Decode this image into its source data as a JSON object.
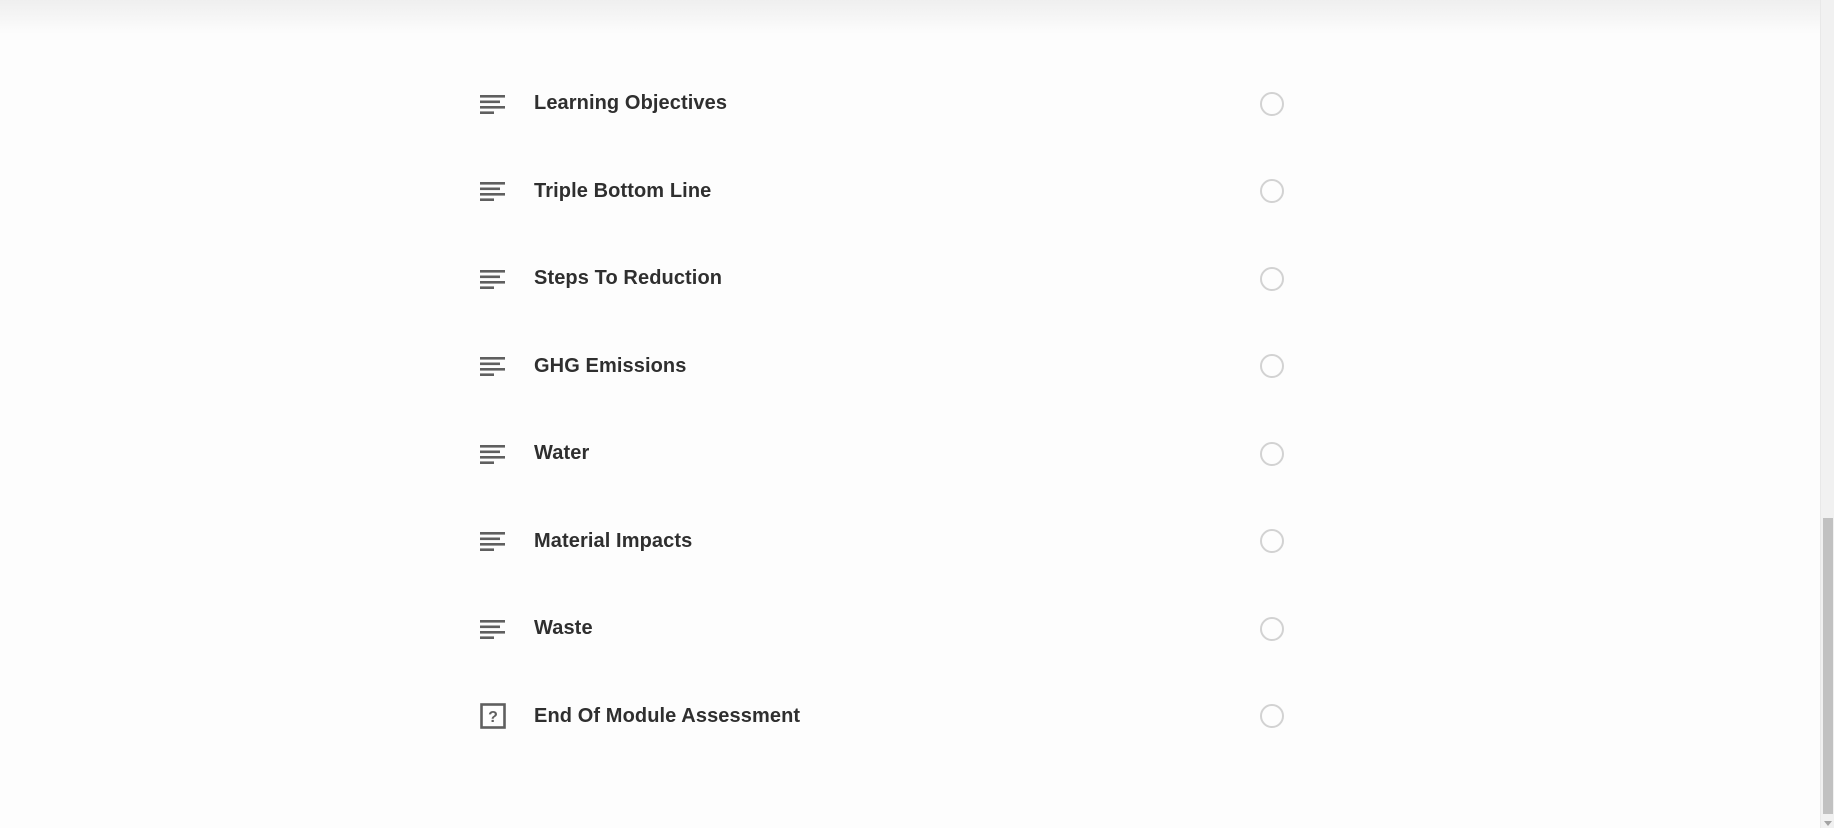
{
  "lessons": [
    {
      "title": "Learning Objectives",
      "icon": "text-lines-icon"
    },
    {
      "title": "Triple Bottom Line",
      "icon": "text-lines-icon"
    },
    {
      "title": "Steps To Reduction",
      "icon": "text-lines-icon"
    },
    {
      "title": "GHG Emissions",
      "icon": "text-lines-icon"
    },
    {
      "title": "Water",
      "icon": "text-lines-icon"
    },
    {
      "title": "Material Impacts",
      "icon": "text-lines-icon"
    },
    {
      "title": "Waste",
      "icon": "text-lines-icon"
    },
    {
      "title": "End Of Module Assessment",
      "icon": "quiz-question-icon"
    }
  ],
  "colors": {
    "background": "#fdfdfd",
    "text": "#2f2f2f",
    "icon": "#5f5f5f",
    "status_circle": "#d2d2d2"
  }
}
